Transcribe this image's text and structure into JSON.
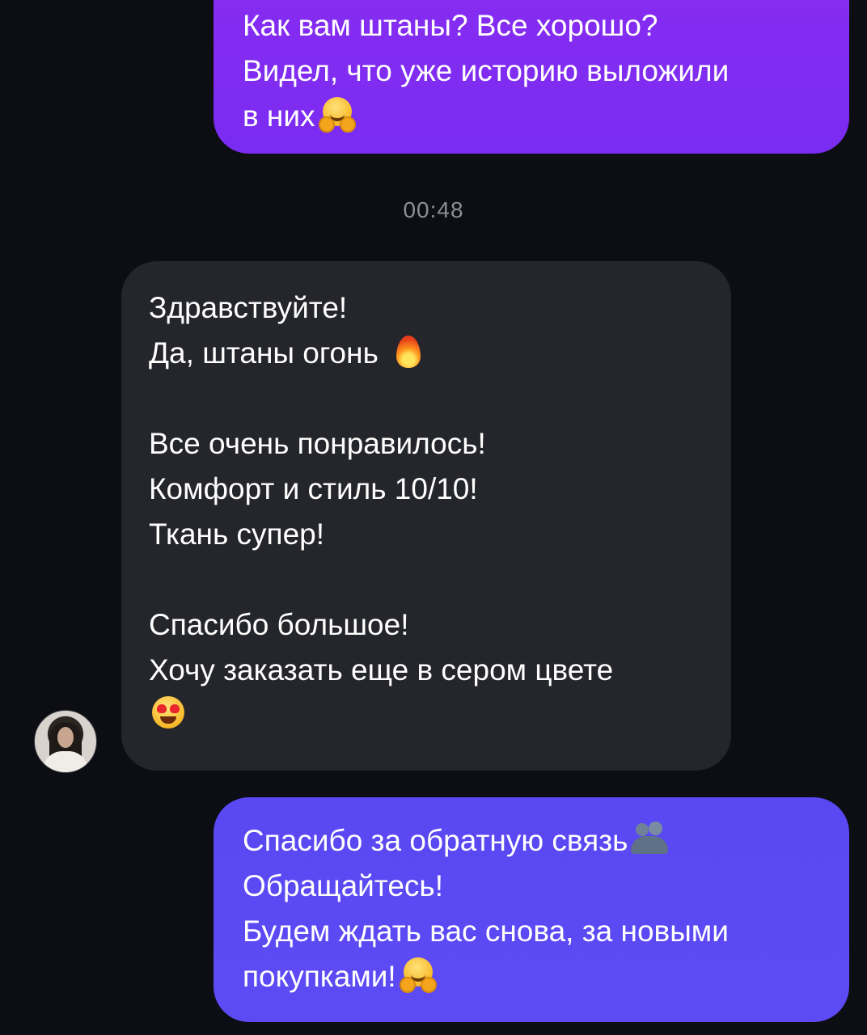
{
  "messages": {
    "outgoing_1": {
      "lines": [
        "Как вам штаны? Все хорошо?",
        "Видел, что уже историю выложили",
        "в них"
      ],
      "emoji_end": "smiling-face-with-open-hands"
    },
    "timestamp": "00:48",
    "incoming_1": {
      "lines": [
        "Здравствуйте!",
        "Да, штаны огонь",
        "",
        "Все очень понравилось!",
        "Комфорт и стиль 10/10!",
        "Ткань супер!",
        "",
        "Спасибо большое!",
        "Хочу заказать еще в сером цвете"
      ],
      "emoji_fire": "fire",
      "emoji_end": "smiling-face-with-heart-eyes"
    },
    "outgoing_2": {
      "lines": [
        "Спасибо за обратную связь",
        "Обращайтесь!",
        "Будем ждать вас снова, за новыми",
        "покупками!"
      ],
      "emoji_1": "people-hugging",
      "emoji_end": "smiling-face-with-open-hands"
    }
  },
  "colors": {
    "background": "#0d0d14",
    "outgoing_top": "#8a2bf0",
    "outgoing_bottom": "#5a48f2",
    "incoming": "#25262c",
    "timestamp_text": "#8e8e99"
  }
}
